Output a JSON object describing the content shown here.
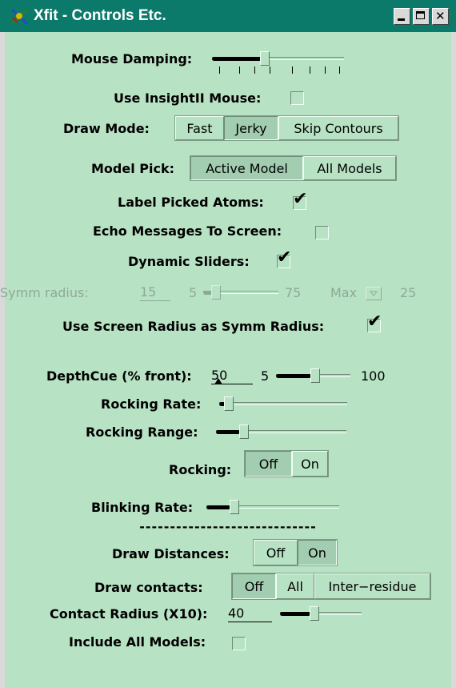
{
  "window": {
    "title": "Xfit - Controls Etc.",
    "icon": "xfit-app-icon"
  },
  "mouse_damping": {
    "label": "Mouse Damping:",
    "level": 0.45
  },
  "insight_mouse": {
    "label": "Use InsightII Mouse:",
    "checked": false
  },
  "draw_mode": {
    "label": "Draw Mode:",
    "options": [
      "Fast",
      "Jerky",
      "Skip Contours"
    ],
    "selected": "Jerky"
  },
  "model_pick": {
    "label": "Model Pick:",
    "options": [
      "Active Model",
      "All Models"
    ],
    "selected": "Active Model"
  },
  "label_picked_atoms": {
    "label": "Label Picked Atoms:",
    "checked": true
  },
  "echo_messages": {
    "label": "Echo Messages To Screen:",
    "checked": false
  },
  "dynamic_sliders": {
    "label": "Dynamic Sliders:",
    "checked": true
  },
  "symm_radius": {
    "label": "Symm radius:",
    "value": "15",
    "min": "5",
    "max": "75",
    "max_label": "Max",
    "max_value": "25",
    "disabled": true
  },
  "use_screen_radius": {
    "label": "Use Screen Radius as Symm Radius:",
    "checked": true
  },
  "depthcue": {
    "label": "DepthCue (% front):",
    "value": "50",
    "min": "5",
    "max": "100"
  },
  "rocking_rate": {
    "label": "Rocking Rate:",
    "level": 0.0
  },
  "rocking_range": {
    "label": "Rocking Range:",
    "level": 0.2
  },
  "rocking": {
    "label": "Rocking:",
    "options": [
      "Off",
      "On"
    ],
    "selected": "Off"
  },
  "blinking_rate": {
    "label": "Blinking Rate:",
    "level": 0.2
  },
  "separator": "-----------------------------",
  "draw_distances": {
    "label": "Draw Distances:",
    "options": [
      "Off",
      "On"
    ],
    "selected": "On"
  },
  "draw_contacts": {
    "label": "Draw contacts:",
    "options": [
      "Off",
      "All",
      "Inter−residue"
    ],
    "selected": "Off"
  },
  "contact_radius": {
    "label": "Contact Radius (X10):",
    "value": "40"
  },
  "include_all_models": {
    "label": "Include All Models:",
    "checked": false
  },
  "colors": {
    "background": "#b8e2c4",
    "titlebar": "#0c7a6a",
    "disabled_text": "#8da996"
  }
}
